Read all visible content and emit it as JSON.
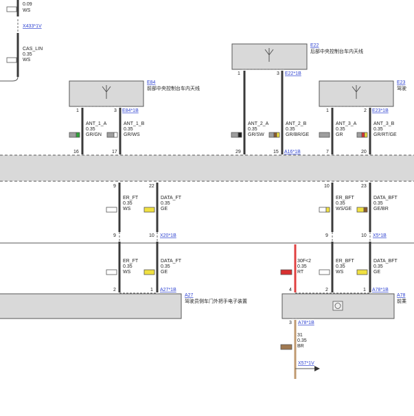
{
  "top_left": {
    "size": "0.09",
    "color": "WS",
    "connector": "X433*1V",
    "wire_name": "CAS_LIN",
    "wire_size": "0.35",
    "wire_color": "WS"
  },
  "e22": {
    "id": "E22",
    "name": "后部中央控制台车内天线",
    "pin_left": "1",
    "pin_right": "3",
    "connector": "E22*1B"
  },
  "e84": {
    "id": "E84",
    "name": "前部中央控制台车内天线",
    "pin_left": "1",
    "pin_right": "3",
    "connector": "E84*1B"
  },
  "e23": {
    "id": "E23",
    "name": "驾驶",
    "pin_left": "1",
    "pin_right": "2",
    "connector": "E23*1B"
  },
  "antenna_wires": [
    {
      "name": "ANT_1_A",
      "size": "0.35",
      "color": "GR/GN",
      "swatch": [
        "#9e9e9e",
        "#2fa33a"
      ]
    },
    {
      "name": "ANT_1_B",
      "size": "0.35",
      "color": "GR/WS",
      "swatch": [
        "#9e9e9e",
        "#ffffff"
      ]
    },
    {
      "name": "ANT_2_A",
      "size": "0.35",
      "color": "GR/SW",
      "swatch": [
        "#9e9e9e",
        "#222222"
      ]
    },
    {
      "name": "ANT_2_B",
      "size": "0.35",
      "color": "GR/BR/GE",
      "swatch": [
        "#9e9e9e",
        "#8b5a2b",
        "#f0e040"
      ]
    },
    {
      "name": "ANT_3_A",
      "size": "0.35",
      "color": "GR",
      "swatch": [
        "#9e9e9e"
      ]
    },
    {
      "name": "ANT_3_B",
      "size": "0.35",
      "color": "GR/RT/GE",
      "swatch": [
        "#9e9e9e",
        "#d83030",
        "#f0e040"
      ]
    }
  ],
  "bus_pins": {
    "p16": "16",
    "p17": "17",
    "p29": "29",
    "p15": "15",
    "p7": "7",
    "p20": "20",
    "connector": "A16*1B"
  },
  "lower_bus_pins": {
    "p9a": "9",
    "p22": "22",
    "p10": "10",
    "p23": "23"
  },
  "left_wires_upper": [
    {
      "name": "ER_FT",
      "size": "0.35",
      "color": "WS",
      "swatch": [
        "#ffffff"
      ]
    },
    {
      "name": "DATA_FT",
      "size": "0.35",
      "color": "GE",
      "swatch": [
        "#f0e040"
      ]
    }
  ],
  "right_wires_upper": [
    {
      "name": "ER_BFT",
      "size": "0.35",
      "color": "WS/GE",
      "swatch": [
        "#ffffff",
        "#f0e040"
      ]
    },
    {
      "name": "DATA_BFT",
      "size": "0.35",
      "color": "GE/BR",
      "swatch": [
        "#f0e040",
        "#8b5a2b"
      ]
    }
  ],
  "x20": {
    "connector": "X20*1B",
    "pin_left": "9",
    "pin_right": "10"
  },
  "x5": {
    "connector": "X5*1B",
    "pin_left": "9",
    "pin_right": "10"
  },
  "left_wires_lower": [
    {
      "name": "ER_FT",
      "size": "0.35",
      "color": "WS",
      "swatch": [
        "#ffffff"
      ]
    },
    {
      "name": "DATA_FT",
      "size": "0.35",
      "color": "GE",
      "swatch": [
        "#f0e040"
      ]
    }
  ],
  "right_wires_lower": [
    {
      "name": "ER_BFT",
      "size": "0.35",
      "color": "WS",
      "swatch": [
        "#ffffff"
      ]
    },
    {
      "name": "DATA_BFT",
      "size": "0.35",
      "color": "GE",
      "swatch": [
        "#f0e040"
      ]
    }
  ],
  "power_wire": {
    "name": "30F<2",
    "size": "0.35",
    "color": "RT",
    "swatch": [
      "#d83030"
    ],
    "pin": "4"
  },
  "a27": {
    "id": "A27",
    "name": "驾驶员侧车门外把手电子装置",
    "pin_left": "2",
    "pin_right": "1",
    "connector": "A27*1B"
  },
  "a78": {
    "id": "A78",
    "name": "前乘",
    "pin_left": "2",
    "pin_right": "1",
    "connector": "A78*1B"
  },
  "ground_wire": {
    "pin": "3",
    "connector": "A78*1B",
    "name": "31",
    "size": "0.35",
    "color": "BR",
    "swatch": [
      "#a07850"
    ],
    "target": "X57*1V"
  }
}
